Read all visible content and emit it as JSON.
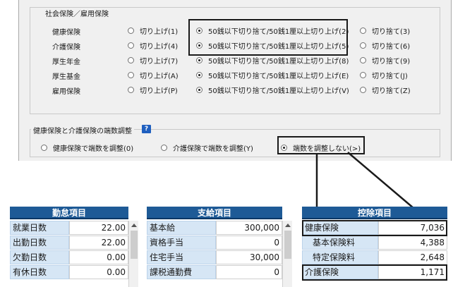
{
  "social_insurance": {
    "group_title": "社会保険／雇用保険",
    "rows": [
      {
        "label": "健康保険",
        "opt1": "切り上げ(1)",
        "opt2": "50銭以下切り捨て/50銭1厘以上切り上げ(2)",
        "opt3": "切り捨て(3)",
        "selected": 2
      },
      {
        "label": "介護保険",
        "opt1": "切り上げ(4)",
        "opt2": "50銭以下切り捨て/50銭1厘以上切り上げ(5)",
        "opt3": "切り捨て(6)",
        "selected": 2
      },
      {
        "label": "厚生年金",
        "opt1": "切り上げ(7)",
        "opt2": "50銭以下切り捨て/50銭1厘以上切り上げ(8)",
        "opt3": "切り捨て(9)",
        "selected": 2
      },
      {
        "label": "厚生基金",
        "opt1": "切り上げ(A)",
        "opt2": "50銭以下切り捨て/50銭1厘以上切り上げ(E)",
        "opt3": "切り捨て(J)",
        "selected": 2
      },
      {
        "label": "雇用保険",
        "opt1": "切り上げ(P)",
        "opt2": "50銭以下切り捨て/50銭1厘以上切り上げ(V)",
        "opt3": "切り捨て(Z)",
        "selected": 2
      }
    ]
  },
  "fraction_adjust": {
    "group_title": "健康保険と介護保険の端数調整",
    "help_icon": "?",
    "opt1": "健康保険で端数を調整(0)",
    "opt2": "介護保険で端数を調整(Y)",
    "opt3": "端数を調整しない(>)",
    "selected": 3
  },
  "attendance": {
    "header": "勤怠項目",
    "rows": [
      {
        "label": "就業日数",
        "value": "22.00"
      },
      {
        "label": "出勤日数",
        "value": "22.00"
      },
      {
        "label": "欠勤日数",
        "value": "0.00"
      },
      {
        "label": "有休日数",
        "value": "0.00"
      }
    ]
  },
  "payments": {
    "header": "支給項目",
    "rows": [
      {
        "label": "基本給",
        "value": "300,000"
      },
      {
        "label": "資格手当",
        "value": "0"
      },
      {
        "label": "住宅手当",
        "value": "30,000"
      },
      {
        "label": "課税通勤費",
        "value": "0"
      }
    ]
  },
  "deductions": {
    "header": "控除項目",
    "rows": [
      {
        "label": "健康保険",
        "value": "7,036"
      },
      {
        "label": "基本保険料",
        "value": "4,388"
      },
      {
        "label": "特定保険料",
        "value": "2,648"
      },
      {
        "label": "介護保険",
        "value": "1,171"
      }
    ]
  },
  "colors": {
    "table_header": "#1e5a96",
    "label_cell": "#d6e6f5",
    "dialog_bg": "#f0f0f0",
    "help_icon": "#1f5fbf"
  }
}
